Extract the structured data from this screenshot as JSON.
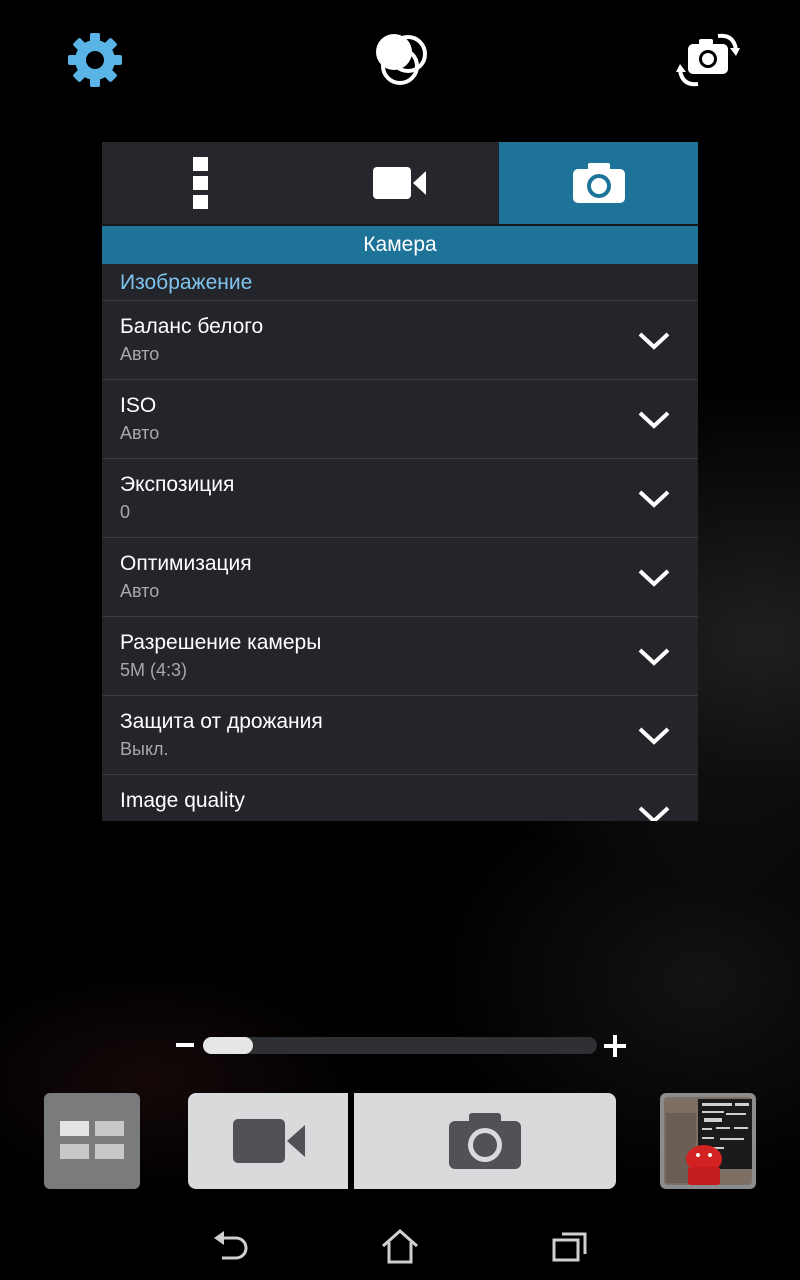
{
  "top_icons": [
    "gear-icon",
    "color-effects-icon",
    "switch-camera-icon"
  ],
  "tabs": [
    {
      "icon": "more-vertical-icon",
      "active": false
    },
    {
      "icon": "video-camera-icon",
      "active": false
    },
    {
      "icon": "camera-icon",
      "active": true
    }
  ],
  "panel": {
    "header": "Камера",
    "section": "Изображение",
    "rows": [
      {
        "label": "Баланс белого",
        "value": "Авто"
      },
      {
        "label": "ISO",
        "value": "Авто"
      },
      {
        "label": "Экспозиция",
        "value": "0"
      },
      {
        "label": "Оптимизация",
        "value": "Авто"
      },
      {
        "label": "Разрешение камеры",
        "value": "5M (4:3)"
      },
      {
        "label": "Защита от дрожания",
        "value": "Выкл."
      },
      {
        "label": "Image quality",
        "value": ""
      }
    ]
  },
  "zoom": {
    "level_fraction": 0.0
  },
  "colors": {
    "accent": "#1e7398",
    "section_text": "#7fc4ee",
    "panel_bg": "#24252a"
  },
  "bottom_icons": [
    "mode-grid-icon",
    "video-record-icon",
    "shutter-camera-icon",
    "gallery-thumbnail"
  ],
  "nav_icons": [
    "back-icon",
    "home-icon",
    "recent-apps-icon"
  ]
}
